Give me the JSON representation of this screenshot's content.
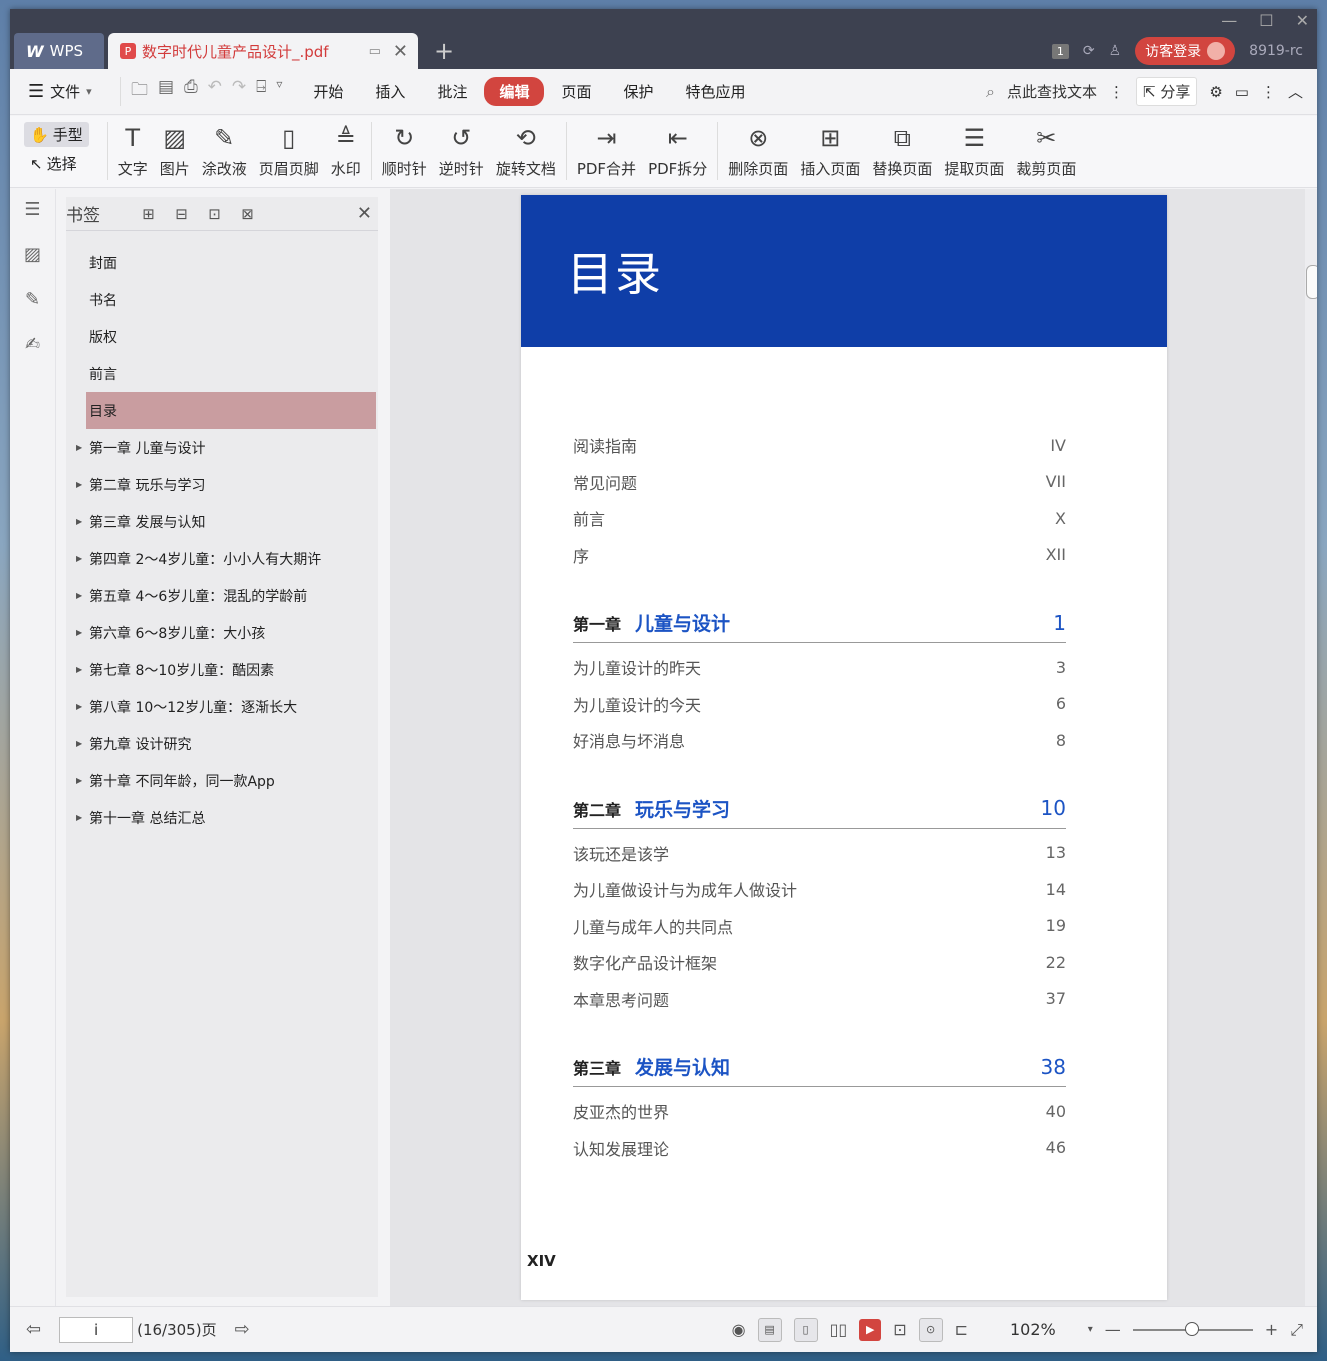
{
  "titlebar": {
    "app_label": "WPS",
    "doc_tab_title": "数字时代儿童产品设计_.pdf",
    "badge_count": "1",
    "login_label": "访客登录",
    "user_id": "8919-rc"
  },
  "menubar": {
    "file_label": "文件",
    "items": [
      "开始",
      "插入",
      "批注",
      "编辑",
      "页面",
      "保护",
      "特色应用"
    ],
    "active_item": "编辑",
    "search_label": "点此查找文本",
    "share_label": "分享"
  },
  "ribbon": {
    "hand_mode": "手型",
    "select_mode": "选择",
    "buttons": [
      "文字",
      "图片",
      "涂改液",
      "页眉页脚",
      "水印",
      "顺时针",
      "逆时针",
      "旋转文档",
      "PDF合并",
      "PDF拆分",
      "删除页面",
      "插入页面",
      "替换页面",
      "提取页面",
      "裁剪页面"
    ]
  },
  "bookmarks": {
    "title": "书签",
    "items": [
      {
        "label": "封面",
        "expandable": false,
        "selected": false
      },
      {
        "label": "书名",
        "expandable": false,
        "selected": false
      },
      {
        "label": "版权",
        "expandable": false,
        "selected": false
      },
      {
        "label": "前言",
        "expandable": false,
        "selected": false
      },
      {
        "label": "目录",
        "expandable": false,
        "selected": true
      },
      {
        "label": "第一章  儿童与设计",
        "expandable": true,
        "selected": false
      },
      {
        "label": "第二章  玩乐与学习",
        "expandable": true,
        "selected": false
      },
      {
        "label": "第三章  发展与认知",
        "expandable": true,
        "selected": false
      },
      {
        "label": "第四章  2～4岁儿童：小小人有大期许",
        "expandable": true,
        "selected": false
      },
      {
        "label": "第五章  4～6岁儿童：混乱的学龄前",
        "expandable": true,
        "selected": false
      },
      {
        "label": "第六章  6～8岁儿童：大小孩",
        "expandable": true,
        "selected": false
      },
      {
        "label": "第七章  8～10岁儿童：酷因素",
        "expandable": true,
        "selected": false
      },
      {
        "label": "第八章  10～12岁儿童：逐渐长大",
        "expandable": true,
        "selected": false
      },
      {
        "label": "第九章  设计研究",
        "expandable": true,
        "selected": false
      },
      {
        "label": "第十章  不同年龄，同一款App",
        "expandable": true,
        "selected": false
      },
      {
        "label": "第十一章  总结汇总",
        "expandable": true,
        "selected": false
      }
    ]
  },
  "page": {
    "title": "目录",
    "front_matter": [
      {
        "label": "阅读指南",
        "page": "IV"
      },
      {
        "label": "常见问题",
        "page": "VII"
      },
      {
        "label": "前言",
        "page": "X"
      },
      {
        "label": "序",
        "page": "XII"
      }
    ],
    "chapters": [
      {
        "no": "第一章",
        "name": "儿童与设计",
        "page": "1",
        "sections": [
          {
            "label": "为儿童设计的昨天",
            "page": "3"
          },
          {
            "label": "为儿童设计的今天",
            "page": "6"
          },
          {
            "label": "好消息与坏消息",
            "page": "8"
          }
        ]
      },
      {
        "no": "第二章",
        "name": "玩乐与学习",
        "page": "10",
        "sections": [
          {
            "label": "该玩还是该学",
            "page": "13"
          },
          {
            "label": "为儿童做设计与为成年人做设计",
            "page": "14"
          },
          {
            "label": "儿童与成年人的共同点",
            "page": "19"
          },
          {
            "label": "数字化产品设计框架",
            "page": "22"
          },
          {
            "label": "本章思考问题",
            "page": "37"
          }
        ]
      },
      {
        "no": "第三章",
        "name": "发展与认知",
        "page": "38",
        "sections": [
          {
            "label": "皮亚杰的世界",
            "page": "40"
          },
          {
            "label": "认知发展理论",
            "page": "46"
          }
        ]
      }
    ],
    "footer": "XIV"
  },
  "statusbar": {
    "page_input": "i",
    "page_count": "(16/305)页",
    "zoom": "102%"
  },
  "colors": {
    "accent_red": "#d2453f",
    "banner_blue": "#0f3ea8",
    "chapter_blue": "#1c54c4",
    "bookmark_selected": "#c99da0"
  }
}
